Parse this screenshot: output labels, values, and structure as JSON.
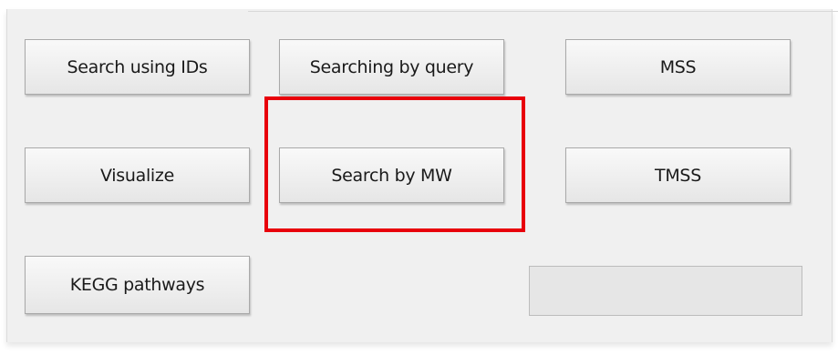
{
  "buttons": {
    "search_ids": "Search using IDs",
    "search_query": "Searching by query",
    "mss": "MSS",
    "visualize": "Visualize",
    "search_mw": "Search by MW",
    "tmss": "TMSS",
    "kegg": "KEGG pathways"
  },
  "highlight": {
    "color": "#e8000b",
    "target": "Search by MW"
  },
  "progress": {
    "value": 0
  }
}
